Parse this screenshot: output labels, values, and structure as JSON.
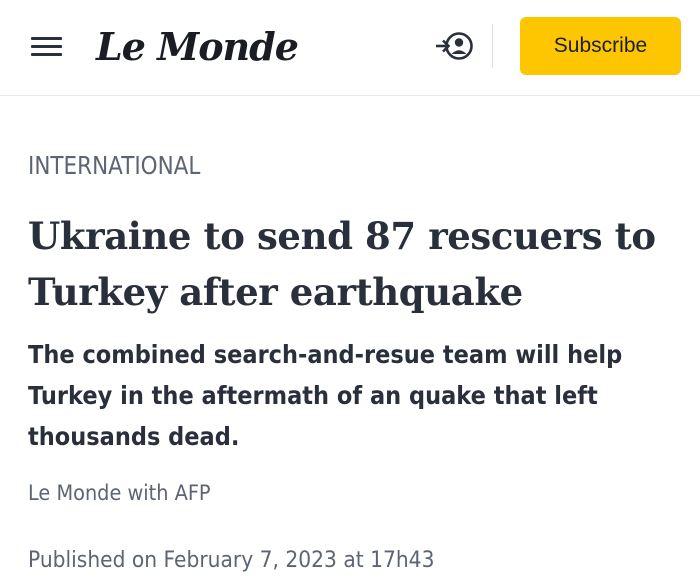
{
  "header": {
    "menu_icon": "hamburger-menu-icon",
    "logo_text": "Le Monde",
    "account_icon": "login-user-icon",
    "subscribe_label": "Subscribe",
    "subscribe_color": "#fdc600"
  },
  "article": {
    "section": "INTERNATIONAL",
    "headline": "Ukraine to send 87 rescuers to Turkey after earthquake",
    "standfirst": "The combined search-and-resue team will help Turkey in the aftermath of an quake that left thousands dead.",
    "byline": "Le Monde with AFP",
    "published": "Published on February 7, 2023 at 17h43"
  }
}
